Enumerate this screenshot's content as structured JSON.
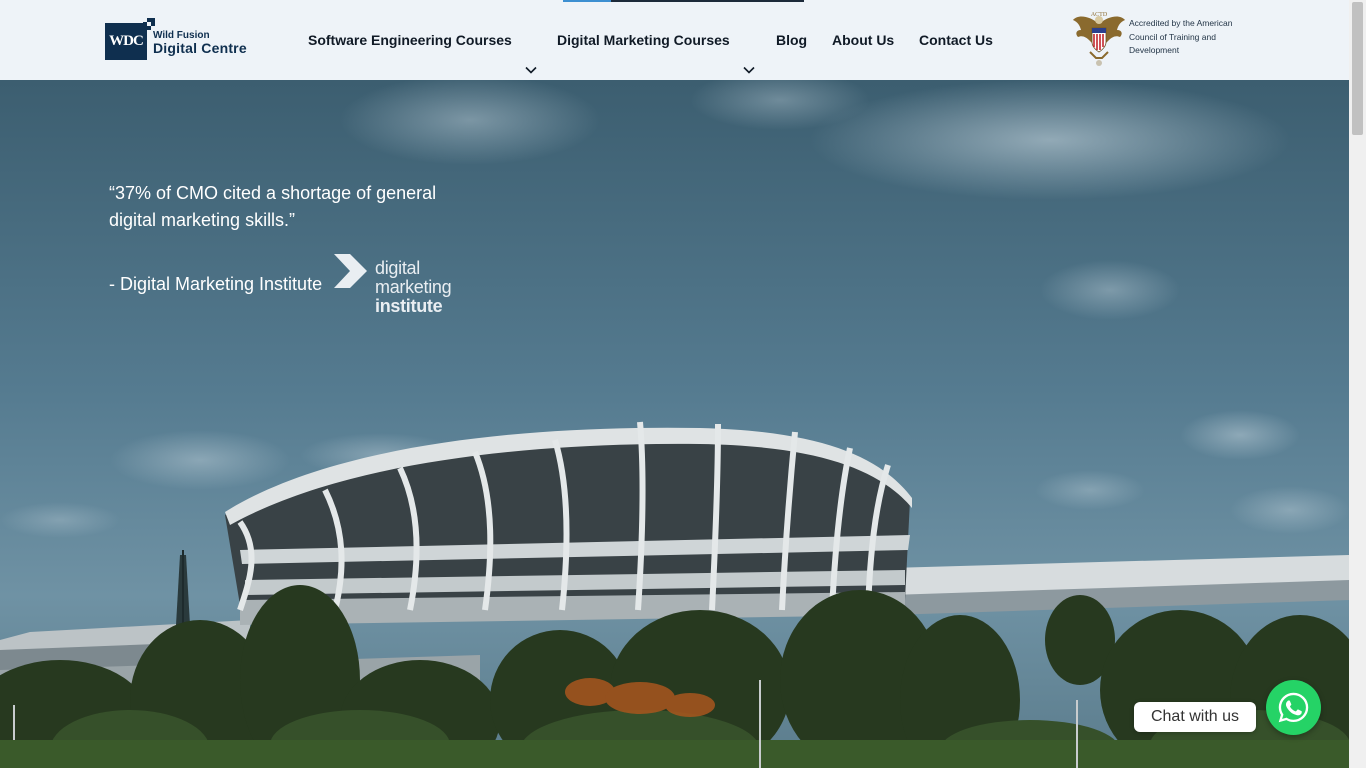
{
  "header": {
    "logo": {
      "mark_text": "WDC",
      "small_text": "Wild Fusion",
      "big_text": "Digital Centre"
    },
    "nav": [
      {
        "label": "Software Engineering Courses",
        "has_dropdown": true,
        "icon": "chevron-down-icon"
      },
      {
        "label": "Digital Marketing Courses",
        "has_dropdown": true,
        "icon": "chevron-down-icon"
      },
      {
        "label": "Blog",
        "has_dropdown": false
      },
      {
        "label": "About Us",
        "has_dropdown": false
      },
      {
        "label": "Contact Us",
        "has_dropdown": false
      }
    ],
    "accreditation": {
      "seal_text": "ACTD",
      "label": "Accredited by the American Council of Training and Development"
    }
  },
  "hero": {
    "quote": "“37% of CMO cited a shortage of general digital marketing skills.”",
    "attribution": "- Digital Marketing Institute",
    "partner_logo": {
      "line1": "digital",
      "line2": "marketing",
      "line3": "institute"
    }
  },
  "chat": {
    "label": "Chat with us",
    "icon": "whatsapp-icon"
  },
  "colors": {
    "header_bg": "#eef3f8",
    "brand_navy": "#0f2f4f",
    "chat_green": "#25d366"
  }
}
